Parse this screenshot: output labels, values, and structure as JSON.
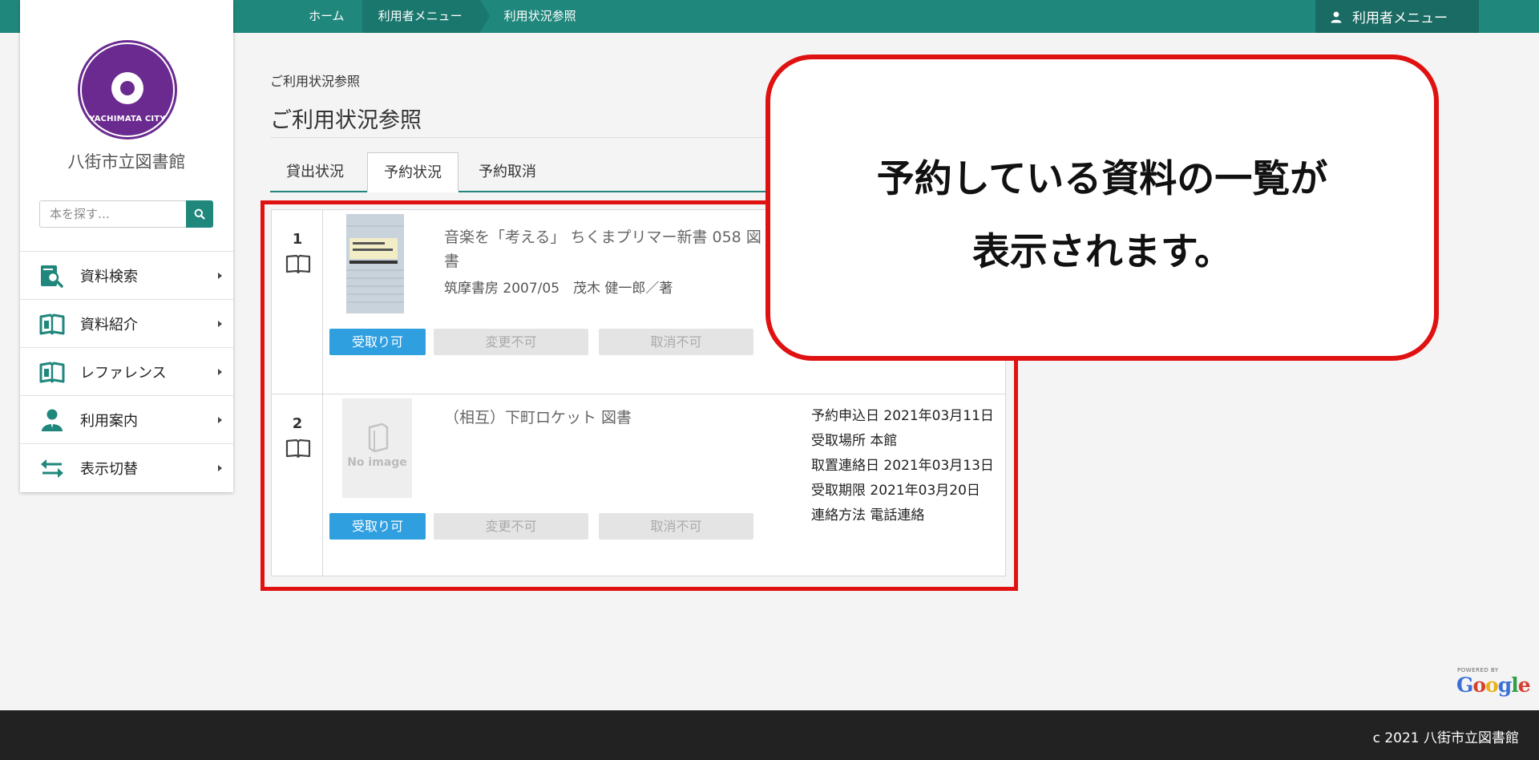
{
  "breadcrumbs": [
    "ホーム",
    "利用者メニュー",
    "利用状況参照"
  ],
  "user_menu": {
    "label": "利用者メニュー",
    "icon": "user-icon"
  },
  "library": {
    "name": "八街市立図書館",
    "logo_text": "YACHIMATA CITY",
    "logo_color": "#6a2a8f"
  },
  "search": {
    "placeholder": "本を探す…",
    "icon": "search-icon"
  },
  "sidebar": {
    "items": [
      {
        "label": "資料検索",
        "icon": "catalog-search-icon"
      },
      {
        "label": "資料紹介",
        "icon": "open-book-icon"
      },
      {
        "label": "レファレンス",
        "icon": "open-book-icon"
      },
      {
        "label": "利用案内",
        "icon": "person-icon"
      },
      {
        "label": "表示切替",
        "icon": "swap-arrows-icon"
      }
    ]
  },
  "page": {
    "breadcrumb_small": "ご利用状況参照",
    "title": "ご利用状況参照"
  },
  "tabs": [
    {
      "label": "貸出状況",
      "active": false
    },
    {
      "label": "予約状況",
      "active": true
    },
    {
      "label": "予約取消",
      "active": false
    }
  ],
  "reservations": [
    {
      "number": "1",
      "title": "音楽を「考える」 ちくまプリマー新書 058 図書",
      "meta": "筑摩書房 2007/05　茂木 健一郎／著",
      "buttons": {
        "pickup": "受取り可",
        "change": "変更不可",
        "cancel": "取消不可"
      }
    },
    {
      "number": "2",
      "title": "（相互）下町ロケット 図書",
      "no_image_label": "No image",
      "buttons": {
        "pickup": "受取り可",
        "change": "変更不可",
        "cancel": "取消不可"
      },
      "details": [
        "予約申込日 2021年03月11日",
        "受取場所 本館",
        "取置連絡日 2021年03月13日",
        "受取期限 2021年03月20日",
        "連絡方法 電話連絡"
      ]
    }
  ],
  "callout": {
    "line1": "予約している資料の一覧が",
    "line2": "表示されます。"
  },
  "powered_by": {
    "label": "POWERED BY",
    "brand": "Google"
  },
  "footer": {
    "copyright": "c 2021 八街市立図書館"
  },
  "colors": {
    "theme": "#20877c",
    "highlight": "#e01111",
    "button_primary": "#2f9fe0"
  }
}
